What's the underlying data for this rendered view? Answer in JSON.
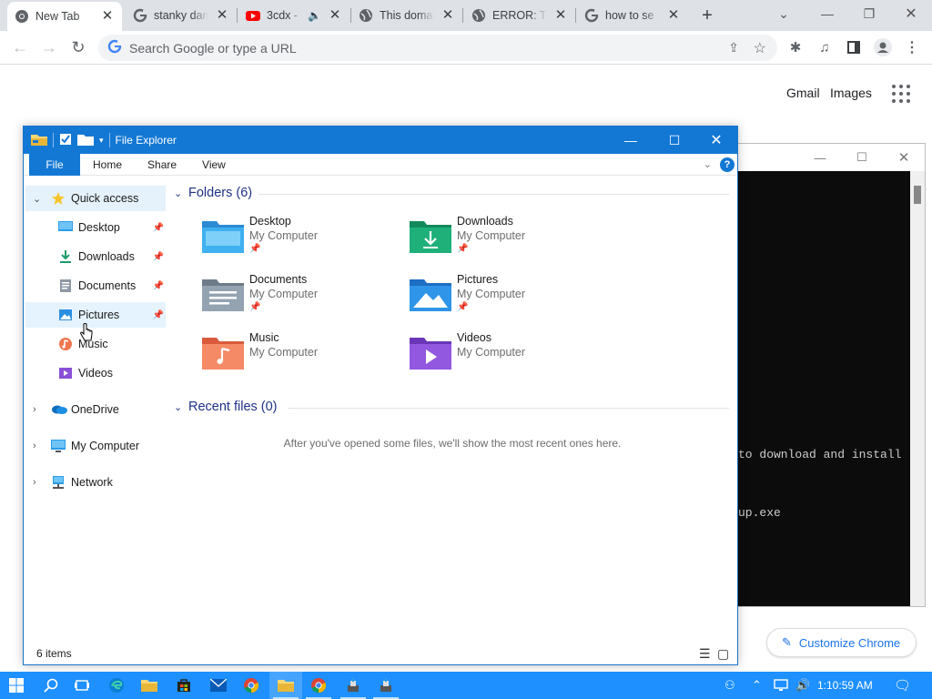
{
  "chrome": {
    "tabs": [
      {
        "title": "New Tab",
        "favicon": "chrome-icon",
        "active": true
      },
      {
        "title": "stanky danky",
        "favicon": "google-icon"
      },
      {
        "title": "3cdx - ",
        "favicon": "youtube-icon",
        "audio": true
      },
      {
        "title": "This domain",
        "favicon": "globe-icon"
      },
      {
        "title": "ERROR: Th",
        "favicon": "globe-icon"
      },
      {
        "title": "how to se",
        "favicon": "google-icon"
      }
    ],
    "omnibox_placeholder": "Search Google or type a URL",
    "links": {
      "gmail": "Gmail",
      "images": "Images"
    },
    "customize_label": "Customize Chrome"
  },
  "console": {
    "lines": [
      "to download and install",
      "up.exe"
    ]
  },
  "explorer": {
    "title": "File Explorer",
    "ribbon_tabs": [
      "File",
      "Home",
      "Share",
      "View"
    ],
    "help_label": "?",
    "nav": {
      "quick_access": "Quick access",
      "pinned": [
        {
          "label": "Desktop",
          "icon": "desktop-icon",
          "pinned": true
        },
        {
          "label": "Downloads",
          "icon": "downloads-icon",
          "pinned": true
        },
        {
          "label": "Documents",
          "icon": "documents-icon",
          "pinned": true
        },
        {
          "label": "Pictures",
          "icon": "pictures-icon",
          "pinned": true
        },
        {
          "label": "Music",
          "icon": "music-icon",
          "pinned": false
        },
        {
          "label": "Videos",
          "icon": "videos-icon",
          "pinned": false
        }
      ],
      "roots": [
        {
          "label": "OneDrive",
          "icon": "onedrive-icon"
        },
        {
          "label": "My Computer",
          "icon": "computer-icon"
        },
        {
          "label": "Network",
          "icon": "network-icon"
        }
      ]
    },
    "folders_header": "Folders (6)",
    "folders": [
      {
        "name": "Desktop",
        "location": "My Computer",
        "pinned": true
      },
      {
        "name": "Downloads",
        "location": "My Computer",
        "pinned": true
      },
      {
        "name": "Documents",
        "location": "My Computer",
        "pinned": true
      },
      {
        "name": "Pictures",
        "location": "My Computer",
        "pinned": true
      },
      {
        "name": "Music",
        "location": "My Computer",
        "pinned": false
      },
      {
        "name": "Videos",
        "location": "My Computer",
        "pinned": false
      }
    ],
    "recent_header": "Recent files (0)",
    "recent_empty": "After you've opened some files, we'll show the most recent ones here.",
    "status_items": "6 items"
  },
  "taskbar": {
    "clock": "1:10:59 AM",
    "accent": "#1e90ff"
  }
}
